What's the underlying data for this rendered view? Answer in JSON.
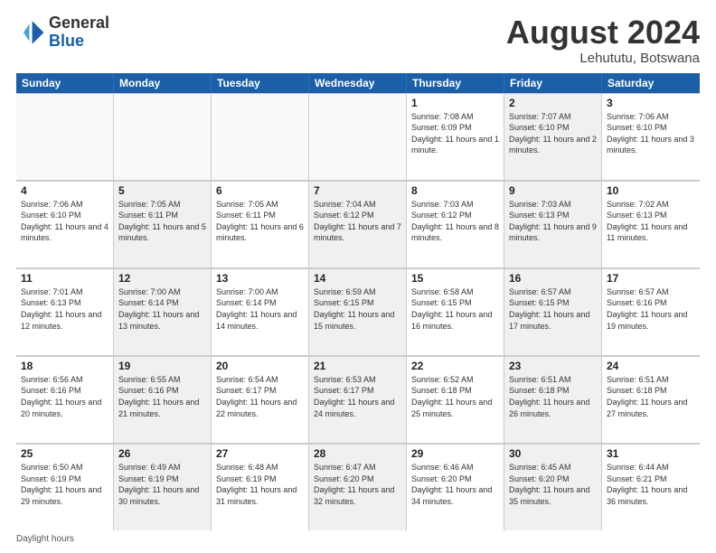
{
  "header": {
    "logo_general": "General",
    "logo_blue": "Blue",
    "month_title": "August 2024",
    "location": "Lehututu, Botswana"
  },
  "days_of_week": [
    "Sunday",
    "Monday",
    "Tuesday",
    "Wednesday",
    "Thursday",
    "Friday",
    "Saturday"
  ],
  "footer": {
    "note": "Daylight hours"
  },
  "weeks": [
    [
      {
        "day": "",
        "info": "",
        "shaded": false,
        "empty": true
      },
      {
        "day": "",
        "info": "",
        "shaded": false,
        "empty": true
      },
      {
        "day": "",
        "info": "",
        "shaded": false,
        "empty": true
      },
      {
        "day": "",
        "info": "",
        "shaded": false,
        "empty": true
      },
      {
        "day": "1",
        "info": "Sunrise: 7:08 AM\nSunset: 6:09 PM\nDaylight: 11 hours\nand 1 minute.",
        "shaded": false,
        "empty": false
      },
      {
        "day": "2",
        "info": "Sunrise: 7:07 AM\nSunset: 6:10 PM\nDaylight: 11 hours\nand 2 minutes.",
        "shaded": true,
        "empty": false
      },
      {
        "day": "3",
        "info": "Sunrise: 7:06 AM\nSunset: 6:10 PM\nDaylight: 11 hours\nand 3 minutes.",
        "shaded": false,
        "empty": false
      }
    ],
    [
      {
        "day": "4",
        "info": "Sunrise: 7:06 AM\nSunset: 6:10 PM\nDaylight: 11 hours\nand 4 minutes.",
        "shaded": false,
        "empty": false
      },
      {
        "day": "5",
        "info": "Sunrise: 7:05 AM\nSunset: 6:11 PM\nDaylight: 11 hours\nand 5 minutes.",
        "shaded": true,
        "empty": false
      },
      {
        "day": "6",
        "info": "Sunrise: 7:05 AM\nSunset: 6:11 PM\nDaylight: 11 hours\nand 6 minutes.",
        "shaded": false,
        "empty": false
      },
      {
        "day": "7",
        "info": "Sunrise: 7:04 AM\nSunset: 6:12 PM\nDaylight: 11 hours\nand 7 minutes.",
        "shaded": true,
        "empty": false
      },
      {
        "day": "8",
        "info": "Sunrise: 7:03 AM\nSunset: 6:12 PM\nDaylight: 11 hours\nand 8 minutes.",
        "shaded": false,
        "empty": false
      },
      {
        "day": "9",
        "info": "Sunrise: 7:03 AM\nSunset: 6:13 PM\nDaylight: 11 hours\nand 9 minutes.",
        "shaded": true,
        "empty": false
      },
      {
        "day": "10",
        "info": "Sunrise: 7:02 AM\nSunset: 6:13 PM\nDaylight: 11 hours\nand 11 minutes.",
        "shaded": false,
        "empty": false
      }
    ],
    [
      {
        "day": "11",
        "info": "Sunrise: 7:01 AM\nSunset: 6:13 PM\nDaylight: 11 hours\nand 12 minutes.",
        "shaded": false,
        "empty": false
      },
      {
        "day": "12",
        "info": "Sunrise: 7:00 AM\nSunset: 6:14 PM\nDaylight: 11 hours\nand 13 minutes.",
        "shaded": true,
        "empty": false
      },
      {
        "day": "13",
        "info": "Sunrise: 7:00 AM\nSunset: 6:14 PM\nDaylight: 11 hours\nand 14 minutes.",
        "shaded": false,
        "empty": false
      },
      {
        "day": "14",
        "info": "Sunrise: 6:59 AM\nSunset: 6:15 PM\nDaylight: 11 hours\nand 15 minutes.",
        "shaded": true,
        "empty": false
      },
      {
        "day": "15",
        "info": "Sunrise: 6:58 AM\nSunset: 6:15 PM\nDaylight: 11 hours\nand 16 minutes.",
        "shaded": false,
        "empty": false
      },
      {
        "day": "16",
        "info": "Sunrise: 6:57 AM\nSunset: 6:15 PM\nDaylight: 11 hours\nand 17 minutes.",
        "shaded": true,
        "empty": false
      },
      {
        "day": "17",
        "info": "Sunrise: 6:57 AM\nSunset: 6:16 PM\nDaylight: 11 hours\nand 19 minutes.",
        "shaded": false,
        "empty": false
      }
    ],
    [
      {
        "day": "18",
        "info": "Sunrise: 6:56 AM\nSunset: 6:16 PM\nDaylight: 11 hours\nand 20 minutes.",
        "shaded": false,
        "empty": false
      },
      {
        "day": "19",
        "info": "Sunrise: 6:55 AM\nSunset: 6:16 PM\nDaylight: 11 hours\nand 21 minutes.",
        "shaded": true,
        "empty": false
      },
      {
        "day": "20",
        "info": "Sunrise: 6:54 AM\nSunset: 6:17 PM\nDaylight: 11 hours\nand 22 minutes.",
        "shaded": false,
        "empty": false
      },
      {
        "day": "21",
        "info": "Sunrise: 6:53 AM\nSunset: 6:17 PM\nDaylight: 11 hours\nand 24 minutes.",
        "shaded": true,
        "empty": false
      },
      {
        "day": "22",
        "info": "Sunrise: 6:52 AM\nSunset: 6:18 PM\nDaylight: 11 hours\nand 25 minutes.",
        "shaded": false,
        "empty": false
      },
      {
        "day": "23",
        "info": "Sunrise: 6:51 AM\nSunset: 6:18 PM\nDaylight: 11 hours\nand 26 minutes.",
        "shaded": true,
        "empty": false
      },
      {
        "day": "24",
        "info": "Sunrise: 6:51 AM\nSunset: 6:18 PM\nDaylight: 11 hours\nand 27 minutes.",
        "shaded": false,
        "empty": false
      }
    ],
    [
      {
        "day": "25",
        "info": "Sunrise: 6:50 AM\nSunset: 6:19 PM\nDaylight: 11 hours\nand 29 minutes.",
        "shaded": false,
        "empty": false
      },
      {
        "day": "26",
        "info": "Sunrise: 6:49 AM\nSunset: 6:19 PM\nDaylight: 11 hours\nand 30 minutes.",
        "shaded": true,
        "empty": false
      },
      {
        "day": "27",
        "info": "Sunrise: 6:48 AM\nSunset: 6:19 PM\nDaylight: 11 hours\nand 31 minutes.",
        "shaded": false,
        "empty": false
      },
      {
        "day": "28",
        "info": "Sunrise: 6:47 AM\nSunset: 6:20 PM\nDaylight: 11 hours\nand 32 minutes.",
        "shaded": true,
        "empty": false
      },
      {
        "day": "29",
        "info": "Sunrise: 6:46 AM\nSunset: 6:20 PM\nDaylight: 11 hours\nand 34 minutes.",
        "shaded": false,
        "empty": false
      },
      {
        "day": "30",
        "info": "Sunrise: 6:45 AM\nSunset: 6:20 PM\nDaylight: 11 hours\nand 35 minutes.",
        "shaded": true,
        "empty": false
      },
      {
        "day": "31",
        "info": "Sunrise: 6:44 AM\nSunset: 6:21 PM\nDaylight: 11 hours\nand 36 minutes.",
        "shaded": false,
        "empty": false
      }
    ]
  ]
}
